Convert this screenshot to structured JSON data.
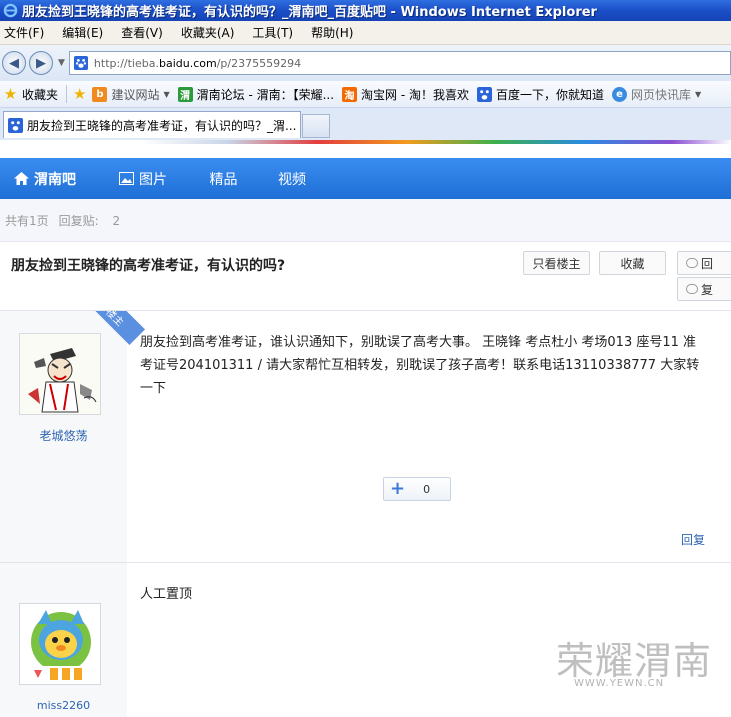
{
  "window": {
    "title": "朋友捡到王晓锋的高考准考证，有认识的吗？_渭南吧_百度贴吧 - Windows Internet Explorer"
  },
  "menu": [
    "文件(F)",
    "编辑(E)",
    "查看(V)",
    "收藏夹(A)",
    "工具(T)",
    "帮助(H)"
  ],
  "address": {
    "prefix": "http://tieba.",
    "host": "baidu.com",
    "path": "/p/2375559294"
  },
  "favorites": {
    "label": "收藏夹",
    "items": [
      "建议网站",
      "渭南论坛 - 渭南：【荣耀...",
      "淘宝网 - 淘！我喜欢",
      "百度一下，你就知道",
      "网页快讯库"
    ]
  },
  "tab": {
    "title": "朋友捡到王晓锋的高考准考证，有认识的吗？_渭..."
  },
  "nav": {
    "home": "渭南吧",
    "pics": "图片",
    "jingpin": "精品",
    "video": "视频"
  },
  "pageinfo": {
    "total_pages": "共有1页",
    "replies_label": "回复贴:",
    "replies_count": "2"
  },
  "thread": {
    "title": "朋友捡到王晓锋的高考准考证，有认识的吗?",
    "only_op": "只看楼主",
    "collect": "收藏",
    "reply_a": "回",
    "reply_b": "复"
  },
  "posts": [
    {
      "badge": "楼主",
      "user": "老城悠荡",
      "content": "朋友捡到高考准考证，谁认识通知下，别耽误了高考大事。 王晓锋 考点杜小 考场013 座号11 准考证号204101311 / 请大家帮忙互相转发，别耽误了孩子高考！联系电话13110338777 大家转一下",
      "likes": "0",
      "reply": "回复"
    },
    {
      "user": "miss2260",
      "content": "人工置顶"
    }
  ],
  "watermark": {
    "text": "荣耀渭南",
    "url": "WWW.YEWN.CN"
  },
  "colors": {
    "nav": "#2a7de6",
    "link": "#2d64b3",
    "ie_title": "#1b4fc8"
  }
}
